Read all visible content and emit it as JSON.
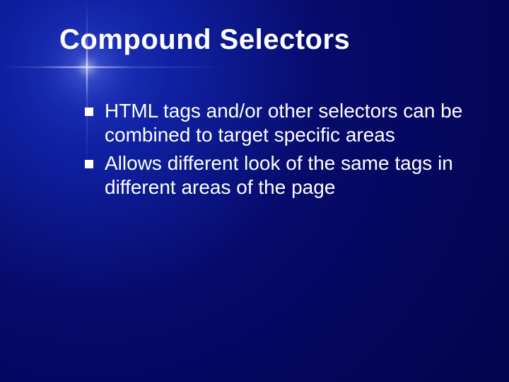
{
  "slide": {
    "title": "Compound Selectors",
    "bullets": [
      "HTML tags and/or other selectors can be combined to target specific areas",
      "Allows different look of the same tags in different areas of the page"
    ]
  }
}
